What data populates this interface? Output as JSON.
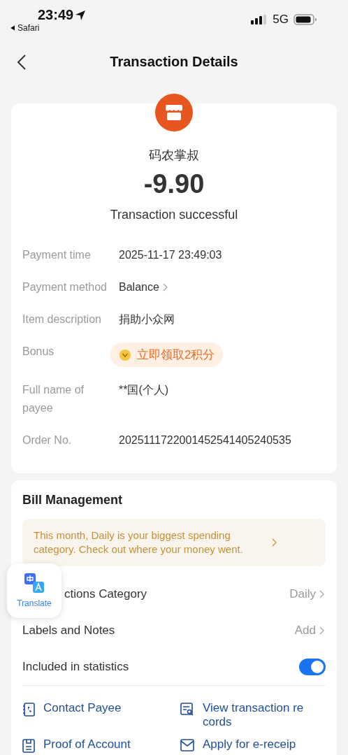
{
  "status_bar": {
    "time": "23:49",
    "back_app": "Safari",
    "network": "5G"
  },
  "nav": {
    "title": "Transaction Details"
  },
  "merchant": {
    "name": "码农掌叔",
    "amount": "-9.90",
    "status": "Transaction successful"
  },
  "details": [
    {
      "label": "Payment time",
      "value": "2025-11-17 23:49:03",
      "kind": "text"
    },
    {
      "label": "Payment method",
      "value": "Balance",
      "kind": "link"
    },
    {
      "label": "Item description",
      "value": "捐助小众网",
      "kind": "text"
    },
    {
      "label": "Bonus",
      "value": "立即领取2积分",
      "kind": "bonus"
    },
    {
      "label": "Full name of payee",
      "value": "**国(个人)",
      "kind": "text"
    },
    {
      "label": "Order No.",
      "value": "2025111722001452541405240535",
      "kind": "text"
    }
  ],
  "bill": {
    "title": "Bill Management",
    "banner": "This month, Daily is your biggest spending category. Check out where your money went.",
    "rows": [
      {
        "label": "ctions Category",
        "value": "Daily"
      },
      {
        "label": "Labels and Notes",
        "value": "Add"
      }
    ],
    "toggle": {
      "label": "Included in statistics",
      "on": true
    },
    "actions": [
      {
        "label": "Contact Payee",
        "kind": "contact"
      },
      {
        "label": "View transaction records",
        "kind": "records"
      },
      {
        "label": "Proof of Account",
        "kind": "proof"
      },
      {
        "label": "Apply for e-receip",
        "kind": "receipt"
      }
    ]
  },
  "translate": {
    "label": "Translate"
  }
}
